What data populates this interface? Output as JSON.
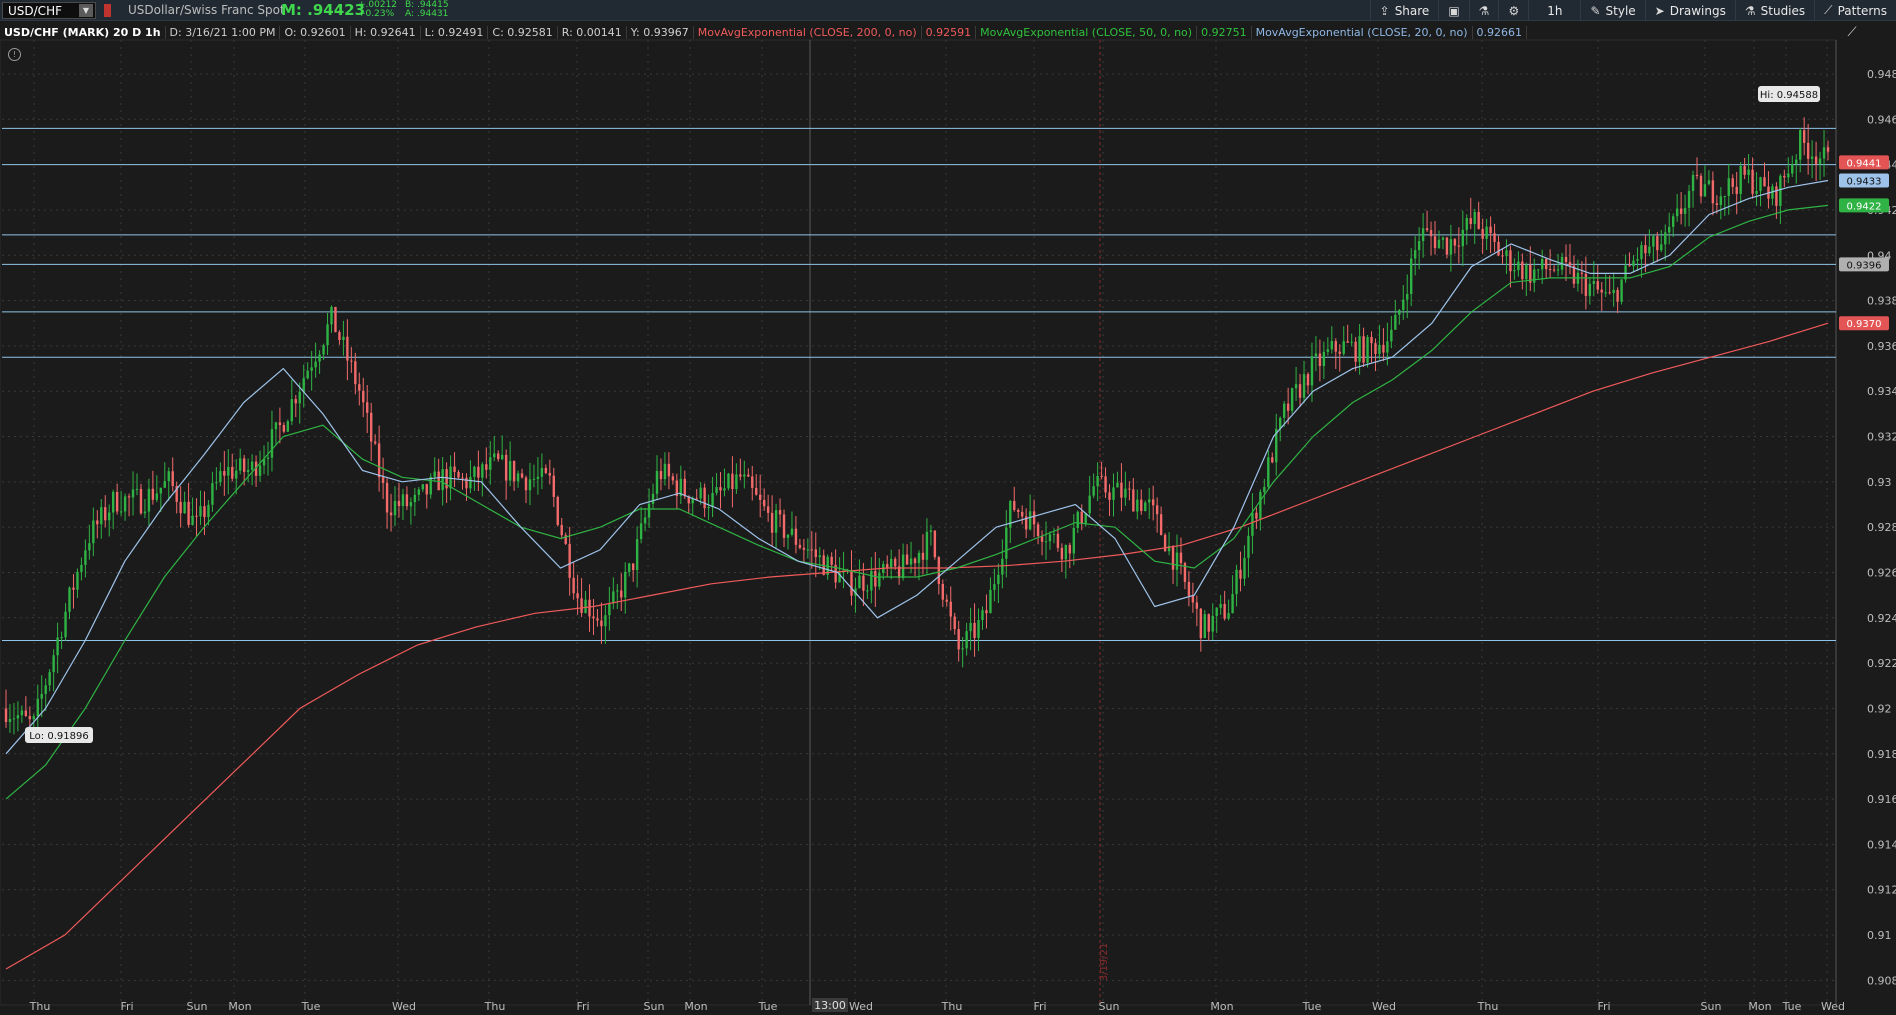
{
  "toolbar": {
    "symbol": "USD/CHF",
    "description": "USDollar/Swiss Franc Spot",
    "mark": "M: .94423",
    "change_abs": "+.00212",
    "change_pct": "+0.23%",
    "bid": "B: .94415",
    "ask": "A: .94431",
    "buttons": {
      "share": "Share",
      "aggregation": "1h",
      "style": "Style",
      "drawings": "Drawings",
      "studies": "Studies",
      "patterns": "Patterns"
    }
  },
  "infobar": {
    "title": "USD/CHF (MARK) 20 D 1h",
    "date": "D: 3/16/21 1:00 PM",
    "open": "O: 0.92601",
    "high": "H: 0.92641",
    "low": "L: 0.92491",
    "close": "C: 0.92581",
    "range": "R: 0.00141",
    "y": "Y: 0.93967",
    "ema200_label": "MovAvgExponential (CLOSE, 200, 0, no)",
    "ema200_value": "0.92591",
    "ema50_label": "MovAvgExponential (CLOSE, 50, 0, no)",
    "ema50_value": "0.92751",
    "ema20_label": "MovAvgExponential (CLOSE, 20, 0, no)",
    "ema20_value": "0.92661"
  },
  "colors": {
    "up": "#2fb344",
    "down": "#f26a6a",
    "ema200": "#f05a5a",
    "ema50": "#2fb344",
    "ema20": "#9ec3ea",
    "hline": "#8fc3e8",
    "grid": "#3a3a3a"
  },
  "chart_data": {
    "type": "candlestick",
    "ylim": [
      0.907,
      0.9495
    ],
    "y_ticks": [
      "0.948",
      "0.946",
      "0.944",
      "0.942",
      "0.94",
      "0.938",
      "0.936",
      "0.934",
      "0.932",
      "0.93",
      "0.928",
      "0.926",
      "0.924",
      "0.922",
      "0.92",
      "0.918",
      "0.916",
      "0.914",
      "0.912",
      "0.91",
      "0.908"
    ],
    "x_labels": [
      "Thu",
      "Fri",
      "Sun",
      "Mon",
      "Tue",
      "Wed",
      "Thu",
      "Fri",
      "Sun",
      "Mon",
      "Tue",
      "Wed",
      "Thu",
      "Fri",
      "Sun",
      "Mon",
      "Tue",
      "Wed",
      "Thu",
      "Fri",
      "Sun",
      "Mon",
      "Tue",
      "Wed"
    ],
    "cursor_x_label": "13:00",
    "vertical_date_label": "3/19/21",
    "high_label": "Hi: 0.94588",
    "low_label": "Lo: 0.91896",
    "horizontal_lines": [
      0.9456,
      0.944,
      0.9409,
      0.9396,
      0.9375,
      0.9355,
      0.923
    ],
    "price_tags": [
      {
        "text": "0.9441",
        "kind": "last",
        "value": 0.9441
      },
      {
        "text": "0.9433",
        "kind": "ema20",
        "value": 0.9433
      },
      {
        "text": "0.9422",
        "kind": "ema50",
        "value": 0.9422
      },
      {
        "text": "0.9396",
        "kind": "line",
        "value": 0.9396
      },
      {
        "text": "0.9370",
        "kind": "ema200",
        "value": 0.937
      }
    ],
    "close_path": [
      0.92,
      0.9192,
      0.9235,
      0.9275,
      0.9292,
      0.9292,
      0.93,
      0.928,
      0.9305,
      0.9305,
      0.9322,
      0.9348,
      0.9372,
      0.934,
      0.929,
      0.929,
      0.9302,
      0.93,
      0.9308,
      0.9302,
      0.93,
      0.925,
      0.9238,
      0.9262,
      0.9305,
      0.9295,
      0.9292,
      0.9302,
      0.9285,
      0.9275,
      0.9265,
      0.9255,
      0.9258,
      0.9262,
      0.9275,
      0.9225,
      0.924,
      0.929,
      0.928,
      0.927,
      0.9298,
      0.9295,
      0.929,
      0.9265,
      0.9235,
      0.9245,
      0.929,
      0.933,
      0.935,
      0.936,
      0.9358,
      0.9365,
      0.941,
      0.9405,
      0.9415,
      0.94,
      0.9392,
      0.9395,
      0.9388,
      0.938,
      0.94,
      0.9405,
      0.943,
      0.9428,
      0.9435,
      0.9425,
      0.945,
      0.9441
    ],
    "ema20_path": [
      0.918,
      0.92,
      0.923,
      0.9265,
      0.929,
      0.9312,
      0.9335,
      0.935,
      0.933,
      0.9305,
      0.93,
      0.9302,
      0.93,
      0.928,
      0.9262,
      0.927,
      0.929,
      0.9295,
      0.9288,
      0.9275,
      0.9265,
      0.926,
      0.924,
      0.925,
      0.9265,
      0.928,
      0.9285,
      0.929,
      0.9275,
      0.9245,
      0.925,
      0.928,
      0.932,
      0.934,
      0.935,
      0.9355,
      0.937,
      0.9395,
      0.9405,
      0.9398,
      0.9392,
      0.9392,
      0.94,
      0.9418,
      0.9425,
      0.943,
      0.9433
    ],
    "ema50_path": [
      0.916,
      0.9175,
      0.92,
      0.923,
      0.9258,
      0.928,
      0.93,
      0.932,
      0.9325,
      0.931,
      0.9302,
      0.93,
      0.929,
      0.928,
      0.9275,
      0.928,
      0.9288,
      0.9288,
      0.928,
      0.9272,
      0.9265,
      0.9262,
      0.9258,
      0.9258,
      0.9262,
      0.9268,
      0.9275,
      0.9282,
      0.928,
      0.9265,
      0.9262,
      0.9275,
      0.93,
      0.932,
      0.9335,
      0.9345,
      0.9358,
      0.9375,
      0.9388,
      0.939,
      0.939,
      0.939,
      0.9395,
      0.9408,
      0.9415,
      0.942,
      0.9422
    ],
    "ema200_path": [
      0.9085,
      0.91,
      0.9125,
      0.915,
      0.9175,
      0.92,
      0.9215,
      0.9228,
      0.9236,
      0.9242,
      0.9245,
      0.925,
      0.9255,
      0.9258,
      0.926,
      0.9262,
      0.9262,
      0.9263,
      0.9265,
      0.9268,
      0.9272,
      0.928,
      0.929,
      0.93,
      0.931,
      0.932,
      0.933,
      0.934,
      0.9348,
      0.9355,
      0.9362,
      0.937
    ]
  }
}
